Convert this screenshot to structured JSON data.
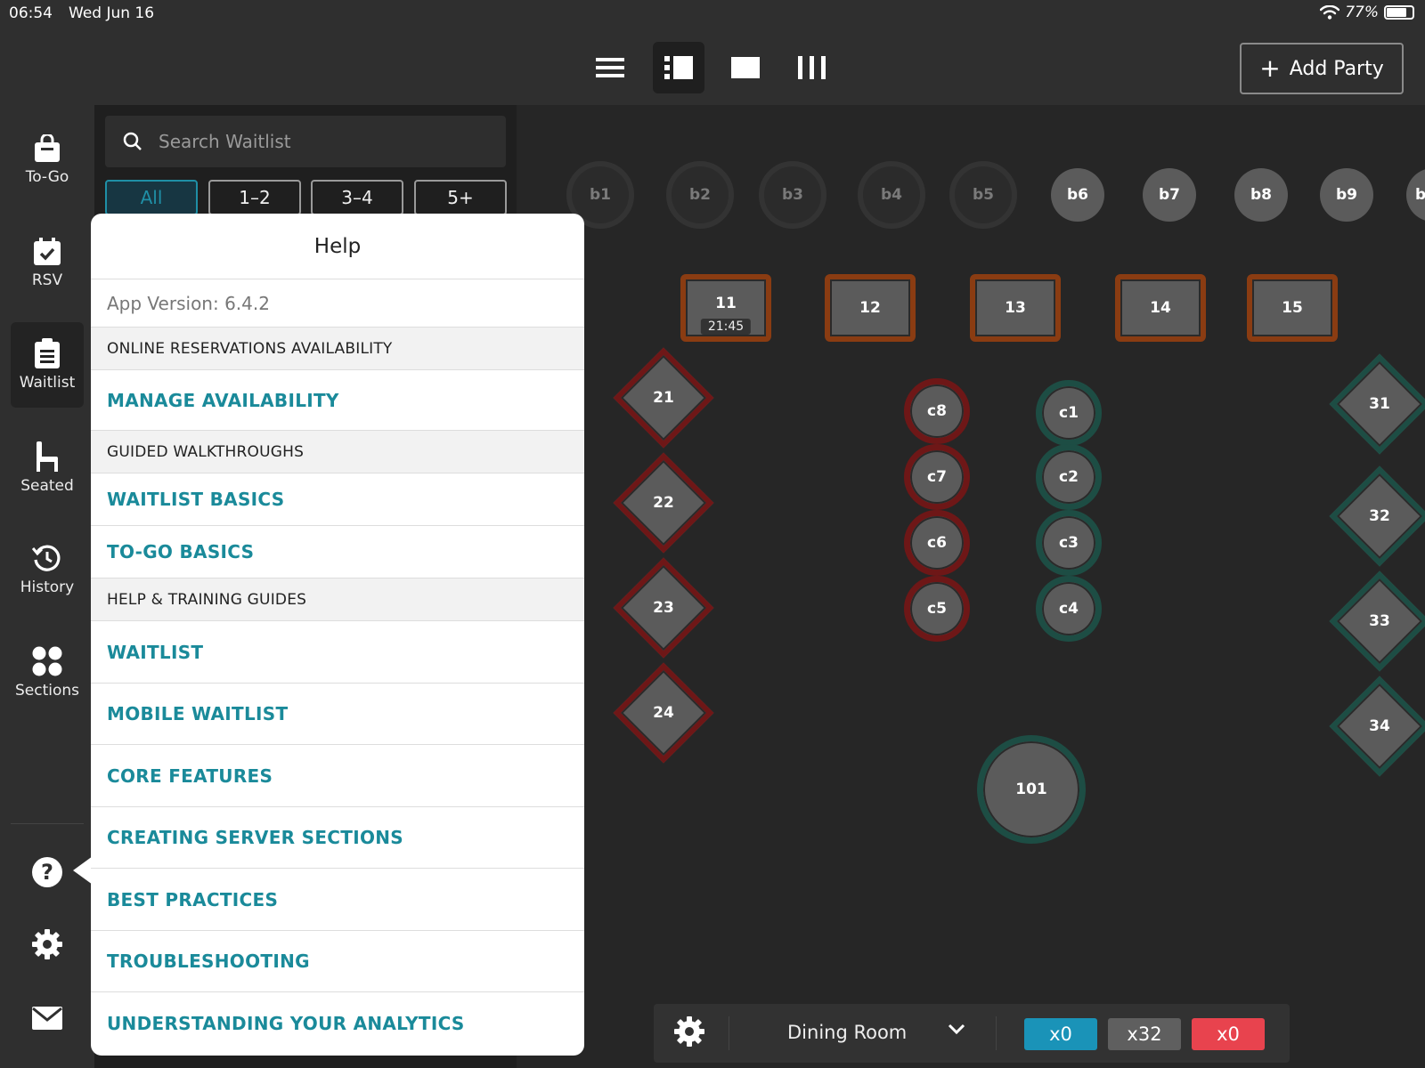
{
  "status_bar": {
    "time": "06:54",
    "date": "Wed Jun 16",
    "battery": "77%",
    "battery_level": 0.77
  },
  "top_bar": {
    "view_icons": [
      "list-view-icon",
      "split-view-icon",
      "floor-view-icon",
      "columns-view-icon"
    ],
    "active_view": "split-view-icon",
    "add_party_label": "Add Party"
  },
  "rail": {
    "items": [
      {
        "label": "To-Go",
        "icon": "shopping-bag-icon"
      },
      {
        "label": "RSV",
        "icon": "calendar-check-icon"
      },
      {
        "label": "Waitlist",
        "icon": "clipboard-icon"
      },
      {
        "label": "Seated",
        "icon": "chair-icon"
      },
      {
        "label": "History",
        "icon": "history-icon"
      },
      {
        "label": "Sections",
        "icon": "sections-icon"
      }
    ],
    "active": "Waitlist",
    "bottom_icons": [
      "help-icon",
      "gear-icon",
      "mail-icon"
    ]
  },
  "waitlist": {
    "search_placeholder": "Search Waitlist",
    "filters": [
      "All",
      "1–2",
      "3–4",
      "5+"
    ],
    "active_filter": "All"
  },
  "help": {
    "title": "Help",
    "version": "App Version: 6.4.2",
    "sections": [
      {
        "heading": "ONLINE RESERVATIONS AVAILABILITY",
        "links": [
          "MANAGE AVAILABILITY"
        ]
      },
      {
        "heading": "GUIDED WALKTHROUGHS",
        "links": [
          "WAITLIST BASICS",
          "TO-GO BASICS"
        ]
      },
      {
        "heading": "HELP & TRAINING GUIDES",
        "links": [
          "WAITLIST",
          "MOBILE WAITLIST",
          "CORE FEATURES",
          "CREATING SERVER SECTIONS",
          "BEST PRACTICES",
          "TROUBLESHOOTING",
          "UNDERSTANDING YOUR ANALYTICS"
        ]
      }
    ]
  },
  "floor": {
    "bar_seats": [
      {
        "label": "b1",
        "active": false
      },
      {
        "label": "b2",
        "active": false
      },
      {
        "label": "b3",
        "active": false
      },
      {
        "label": "b4",
        "active": false
      },
      {
        "label": "b5",
        "active": false
      },
      {
        "label": "b6",
        "active": true
      },
      {
        "label": "b7",
        "active": true
      },
      {
        "label": "b8",
        "active": true
      },
      {
        "label": "b9",
        "active": true
      },
      {
        "label": "b",
        "active": true
      }
    ],
    "square_tables": [
      {
        "label": "11",
        "timer": "21:45"
      },
      {
        "label": "12"
      },
      {
        "label": "13"
      },
      {
        "label": "14"
      },
      {
        "label": "15"
      }
    ],
    "diamond_tables_left": [
      "21",
      "22",
      "23",
      "24"
    ],
    "diamond_tables_right": [
      "31",
      "32",
      "33",
      "34"
    ],
    "c_tables_red": [
      "c8",
      "c7",
      "c6",
      "c5"
    ],
    "c_tables_teal": [
      "c1",
      "c2",
      "c3",
      "c4"
    ],
    "large_table": "101"
  },
  "bottom_bar": {
    "room": "Dining Room",
    "counts": [
      {
        "label": "x0",
        "color": "#1a93b8"
      },
      {
        "label": "x32",
        "color": "#5f5f5f"
      },
      {
        "label": "x0",
        "color": "#e8434e"
      }
    ]
  }
}
